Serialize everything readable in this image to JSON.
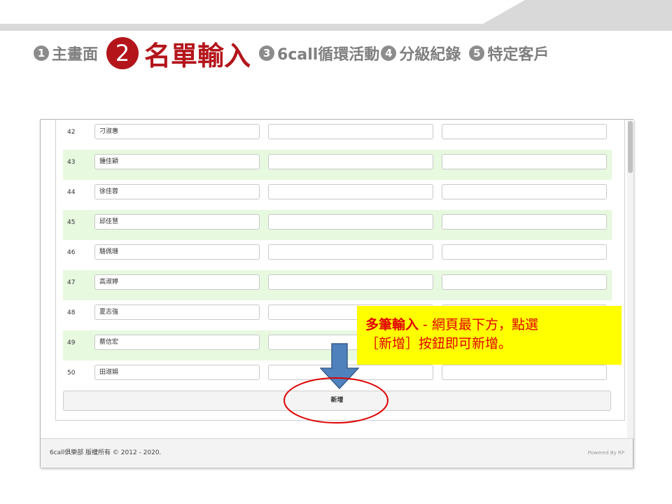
{
  "steps": [
    {
      "num": "1",
      "label": "主畫面"
    },
    {
      "num": "2",
      "label": "名單輸入"
    },
    {
      "num": "3",
      "label": "6call循環活動"
    },
    {
      "num": "4",
      "label": "分級紀錄"
    },
    {
      "num": "5",
      "label": "特定客戶"
    }
  ],
  "rows": [
    {
      "num": "42",
      "name": "刁淑惠",
      "highlight": false
    },
    {
      "num": "43",
      "name": "鍾佳穎",
      "highlight": true
    },
    {
      "num": "44",
      "name": "徐佳蓉",
      "highlight": false
    },
    {
      "num": "45",
      "name": "邱佳慧",
      "highlight": true
    },
    {
      "num": "46",
      "name": "駱佩珊",
      "highlight": false
    },
    {
      "num": "47",
      "name": "高淑婷",
      "highlight": true
    },
    {
      "num": "48",
      "name": "夏志強",
      "highlight": false
    },
    {
      "num": "49",
      "name": "蔡信宏",
      "highlight": true
    },
    {
      "num": "50",
      "name": "田淑娟",
      "highlight": false
    }
  ],
  "add_button": "新增",
  "footer": {
    "copyright": "6call俱樂部 版權所有 © 2012 - 2020.",
    "powered": "Powered By RP"
  },
  "callout": {
    "bold": "多筆輸入",
    "line1_rest": " - 網頁最下方，點選",
    "line2": "［新增］按鈕即可新增。"
  },
  "colors": {
    "accent": "#b3151b",
    "step_gray": "#8c8c8c",
    "row_highlight": "#e7f9df",
    "callout_bg": "#ffff00",
    "callout_text": "#e00000",
    "arrow": "#4f81bd",
    "ellipse": "#e00000"
  },
  "icons": {
    "arrow": "down-arrow-icon",
    "ellipse": "highlight-ellipse"
  }
}
